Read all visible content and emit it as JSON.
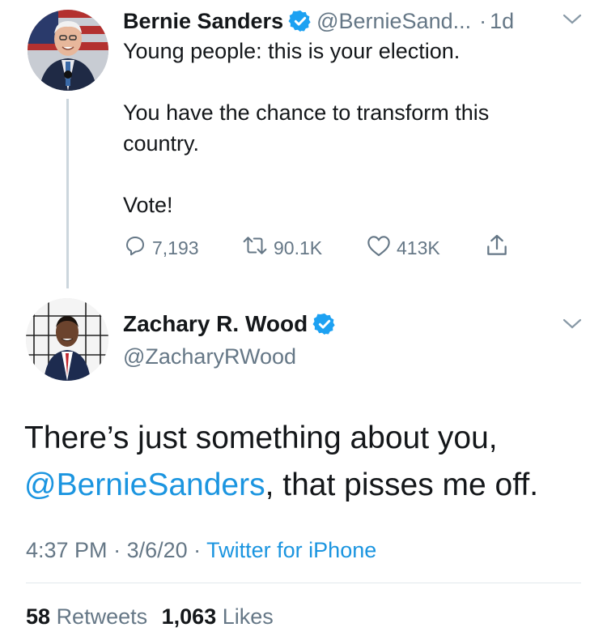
{
  "tweet1": {
    "name": "Bernie Sanders",
    "handle": "@BernieSand...",
    "separator": "·",
    "time": "1d",
    "lines": [
      "Young people: this is your election.",
      "You have the chance to transform this country.",
      "Vote!"
    ],
    "replies": "7,193",
    "retweets": "90.1K",
    "likes": "413K"
  },
  "tweet2": {
    "name": "Zachary R. Wood",
    "handle": "@ZacharyRWood",
    "text_before": "There’s just something about you, ",
    "mention": "@BernieSanders",
    "text_after": ", that pisses me off.",
    "time": "4:37 PM",
    "dot1": " · ",
    "date": "3/6/20",
    "dot2": " · ",
    "source": "Twitter for iPhone",
    "retweet_count": "58",
    "retweet_label": "Retweets",
    "like_count": "1,063",
    "like_label": "Likes"
  },
  "icons": {
    "verified": "verified-badge-icon",
    "chevron": "chevron-down-icon",
    "reply": "reply-icon",
    "retweet": "retweet-icon",
    "like": "heart-icon",
    "share": "share-icon"
  },
  "colors": {
    "link": "#1b95e0",
    "muted": "#657786",
    "verified": "#1da1f2"
  }
}
